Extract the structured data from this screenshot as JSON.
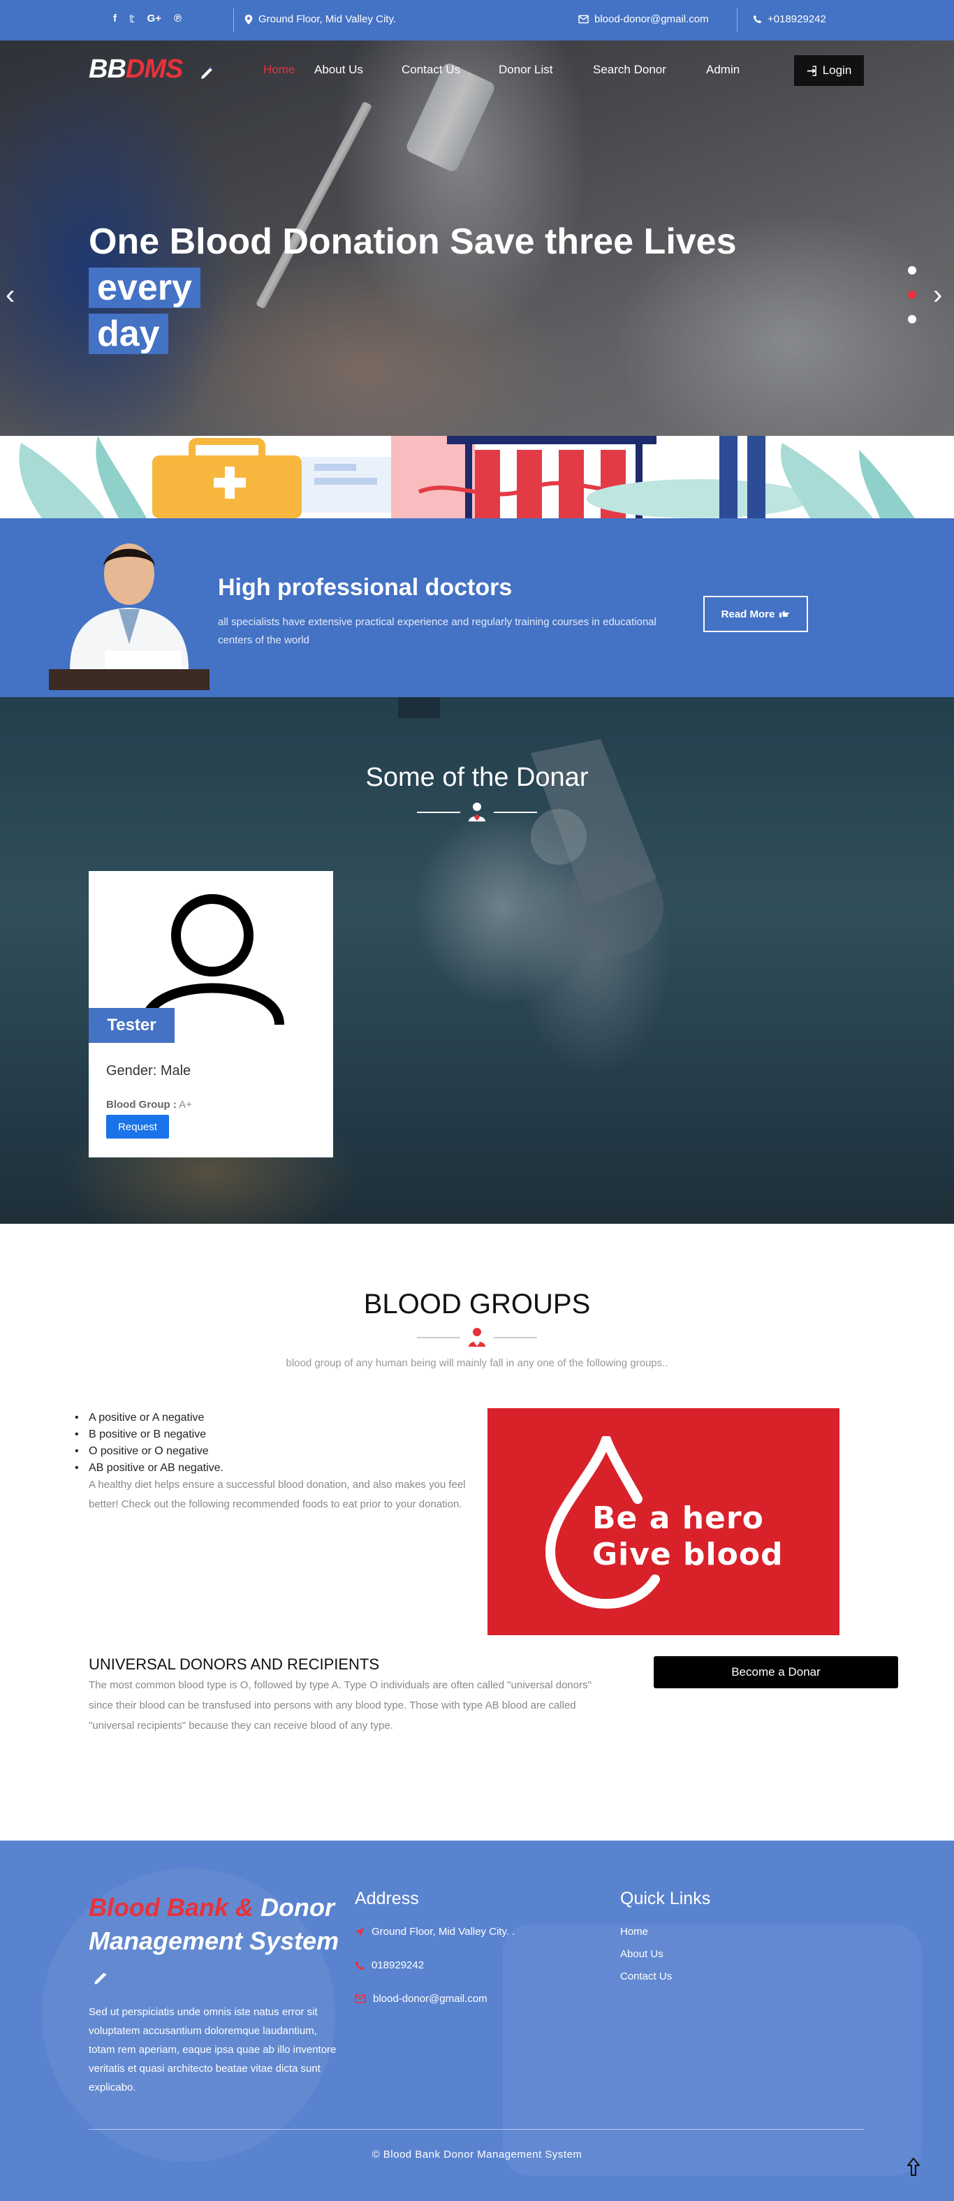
{
  "topbar": {
    "social_icons": [
      "facebook-icon",
      "twitter-icon",
      "google-plus-icon",
      "pinterest-icon"
    ],
    "social_glyphs": [
      "f",
      "𝕥",
      "G+",
      "℗"
    ],
    "address": "Ground Floor, Mid Valley City.",
    "email": "blood-donor@gmail.com",
    "phone": "+018929242"
  },
  "header": {
    "logo_part1": "BB",
    "logo_part2": "DMS",
    "nav": [
      "Home",
      "About Us",
      "Contact Us",
      "Donor List",
      "Search Donor",
      "Admin"
    ],
    "active_nav": "Home",
    "login_label": "Login"
  },
  "hero": {
    "title_main": "One Blood Donation Save three Lives ",
    "title_highlight_1": "every",
    "title_highlight_2": "day",
    "prev_arrow": "‹",
    "next_arrow": "›",
    "slide_count": 3,
    "active_slide": 2
  },
  "doctors": {
    "title": "High professional doctors",
    "description": "all specialists have extensive practical experience and regularly training courses in educational centers of the world",
    "read_more_label": "Read More"
  },
  "donors": {
    "section_title": "Some of the Donar",
    "card": {
      "name": "Tester",
      "gender": "Gender: Male",
      "blood_group_label": "Blood Group :",
      "blood_group_value": "A+",
      "request_label": "Request"
    }
  },
  "blood_groups": {
    "title": "BLOOD GROUPS",
    "subtitle": "blood group of any human being will mainly fall in any one of the following groups..",
    "list": [
      "A positive or A negative",
      "B positive or B negative",
      "O positive or O negative",
      "AB positive or AB negative."
    ],
    "paragraph": "A healthy diet helps ensure a successful blood donation, and also makes you feel better! Check out the following recommended foods to eat prior to your donation.",
    "image_line1": "Be a hero",
    "image_line2": "Give blood",
    "universal_title": "UNIVERSAL DONORS AND RECIPIENTS",
    "universal_text": "The most common blood type is O, followed by type A. Type O individuals are often called \"universal donors\" since their blood can be transfused into persons with any blood type. Those with type AB blood are called \"universal recipients\" because they can receive blood of any type.",
    "become_donor_label": "Become a Donar"
  },
  "footer": {
    "brand_red": "Blood Bank &",
    "brand_white_1": "Donor",
    "brand_white_2": "Management System",
    "description": "Sed ut perspiciatis unde omnis iste natus error sit voluptatem accusantium doloremque laudantium, totam rem aperiam, eaque ipsa quae ab illo inventore veritatis et quasi architecto beatae vitae dicta sunt explicabo.",
    "address_heading": "Address",
    "address": "Ground Floor, Mid Valley City. .",
    "phone": "018929242",
    "email": "blood-donor@gmail.com",
    "links_heading": "Quick Links",
    "links": [
      "Home",
      "About Us",
      "Contact Us"
    ],
    "copyright": "© Blood Bank Donor Management System"
  },
  "colors": {
    "primary_blue": "#4472c4",
    "accent_red": "#e8323b",
    "footer_blue": "#5a83cf",
    "request_blue": "#1a73e8"
  }
}
